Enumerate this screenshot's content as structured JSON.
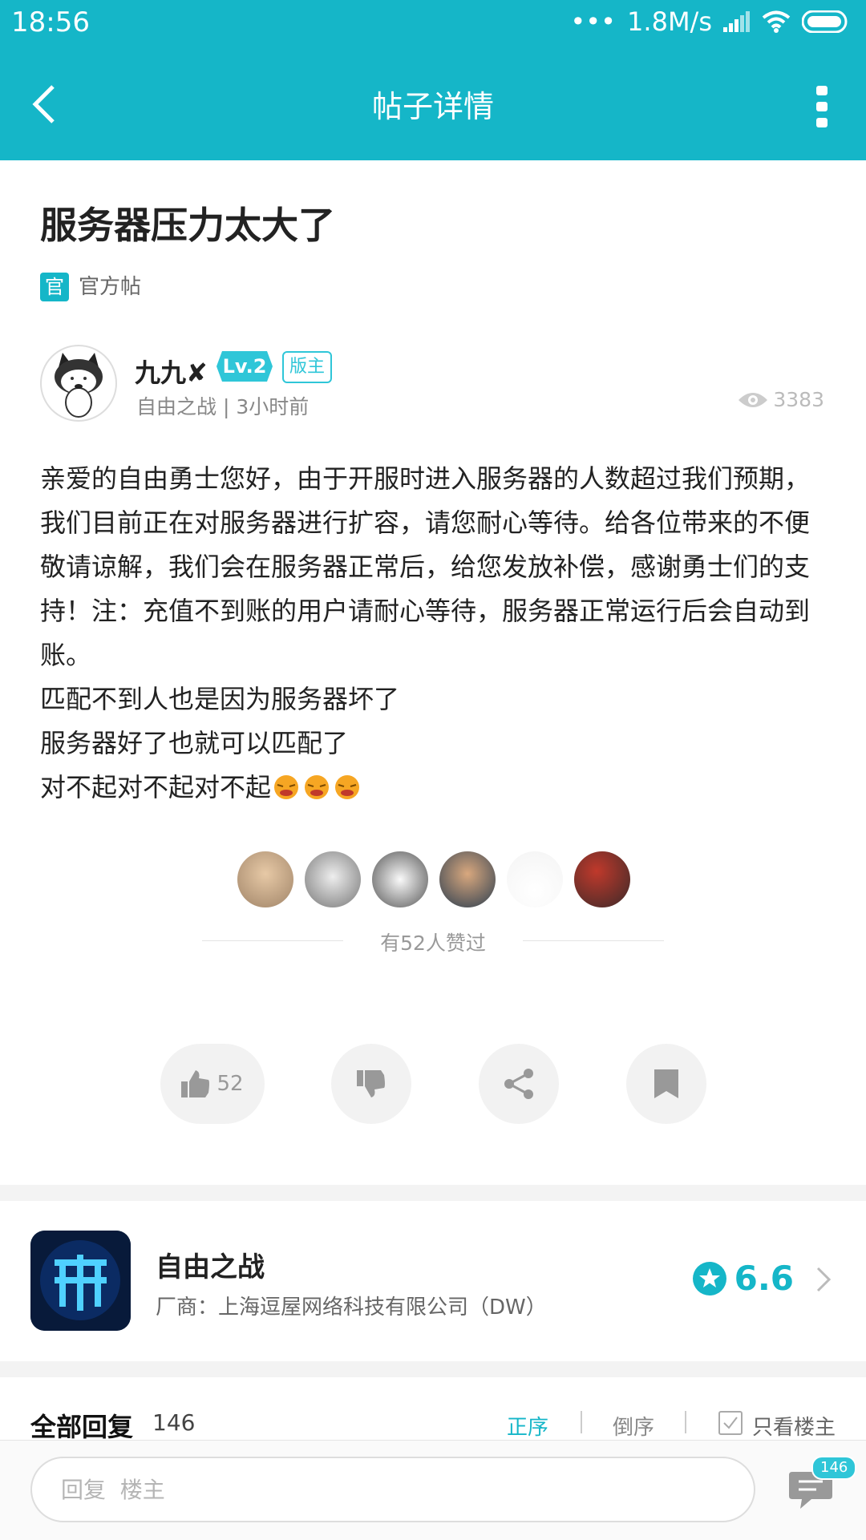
{
  "status_bar": {
    "time": "18:56",
    "network_speed": "1.8M/s"
  },
  "nav": {
    "title": "帖子详情"
  },
  "post": {
    "title": "服务器压力太大了",
    "official_badge": "官",
    "official_label": "官方帖",
    "author": {
      "name": "九九✘",
      "level": "Lv.2",
      "role": "版主",
      "meta": "自由之战 | 3小时前"
    },
    "views": "3383",
    "body": [
      "亲爱的自由勇士您好，由于开服时进入服务器的人数超过我们预期，我们目前正在对服务器进行扩容，请您耐心等待。给各位带来的不便敬请谅解，我们会在服务器正常后，给您发放补偿，感谢勇士们的支持！注：充值不到账的用户请耐心等待，服务器正常运行后会自动到账。",
      "匹配不到人也是因为服务器坏了",
      "服务器好了也就可以匹配了",
      "对不起对不起对不起"
    ],
    "likes_text": "有52人赞过",
    "like_count": "52"
  },
  "game": {
    "name": "自由之战",
    "developer": "厂商：上海逗屋网络科技有限公司（DW）",
    "score": "6.6"
  },
  "replies": {
    "title": "全部回复",
    "count": "146",
    "sort_asc": "正序",
    "sort_desc": "倒序",
    "only_op": "只看楼主"
  },
  "bottom": {
    "placeholder": "回复  楼主",
    "badge": "146"
  },
  "colors": {
    "accent": "#15b6c8"
  },
  "icons": [
    "back-icon",
    "more-icon",
    "eye-icon",
    "thumbs-up-icon",
    "thumbs-down-icon",
    "share-icon",
    "bookmark-icon",
    "star-icon",
    "chevron-right-icon",
    "comment-icon",
    "checkbox-icon"
  ]
}
